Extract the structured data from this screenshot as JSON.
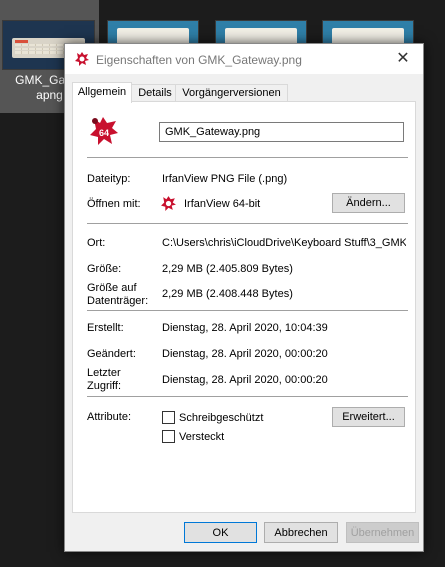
{
  "explorer": {
    "selected_file_label": "GMK_Gatew\napng"
  },
  "dialog": {
    "title": "Eigenschaften von GMK_Gateway.png",
    "close_glyph": "✕",
    "tabs": [
      "Allgemein",
      "Details",
      "Vorgängerversionen"
    ],
    "active_tab": "Allgemein",
    "file_name": "GMK_Gateway.png",
    "icon_badge": "64",
    "fields": {
      "dateityp_label": "Dateityp:",
      "dateityp_value": "IrfanView PNG File (.png)",
      "oeffnen_label": "Öffnen mit:",
      "oeffnen_value": "IrfanView 64-bit",
      "aendern_button": "Ändern...",
      "ort_label": "Ort:",
      "ort_value": "C:\\Users\\chris\\iCloudDrive\\Keyboard Stuff\\3_GMK",
      "groesse_label": "Größe:",
      "groesse_value": "2,29 MB (2.405.809 Bytes)",
      "groesse_dt_label_1": "Größe auf",
      "groesse_dt_label_2": "Datenträger:",
      "groesse_dt_value": "2,29 MB (2.408.448 Bytes)",
      "erstellt_label": "Erstellt:",
      "erstellt_value": "Dienstag, 28. April 2020, 10:04:39",
      "geaendert_label": "Geändert:",
      "geaendert_value": "Dienstag, 28. April 2020, 00:00:20",
      "zugriff_label_1": "Letzter",
      "zugriff_label_2": "Zugriff:",
      "zugriff_value": "Dienstag, 28. April 2020, 00:00:20",
      "attribute_label": "Attribute:",
      "schreibgeschuetzt": "Schreibgeschützt",
      "versteckt": "Versteckt",
      "erweitert_button": "Erweitert..."
    },
    "footer": {
      "ok": "OK",
      "abbrechen": "Abbrechen",
      "uebernehmen": "Übernehmen"
    }
  },
  "colors": {
    "accent": "#0078d7",
    "irfanview_red": "#c8102e"
  },
  "icons": [
    "irfanview-icon",
    "close-icon",
    "checkbox-icon"
  ]
}
